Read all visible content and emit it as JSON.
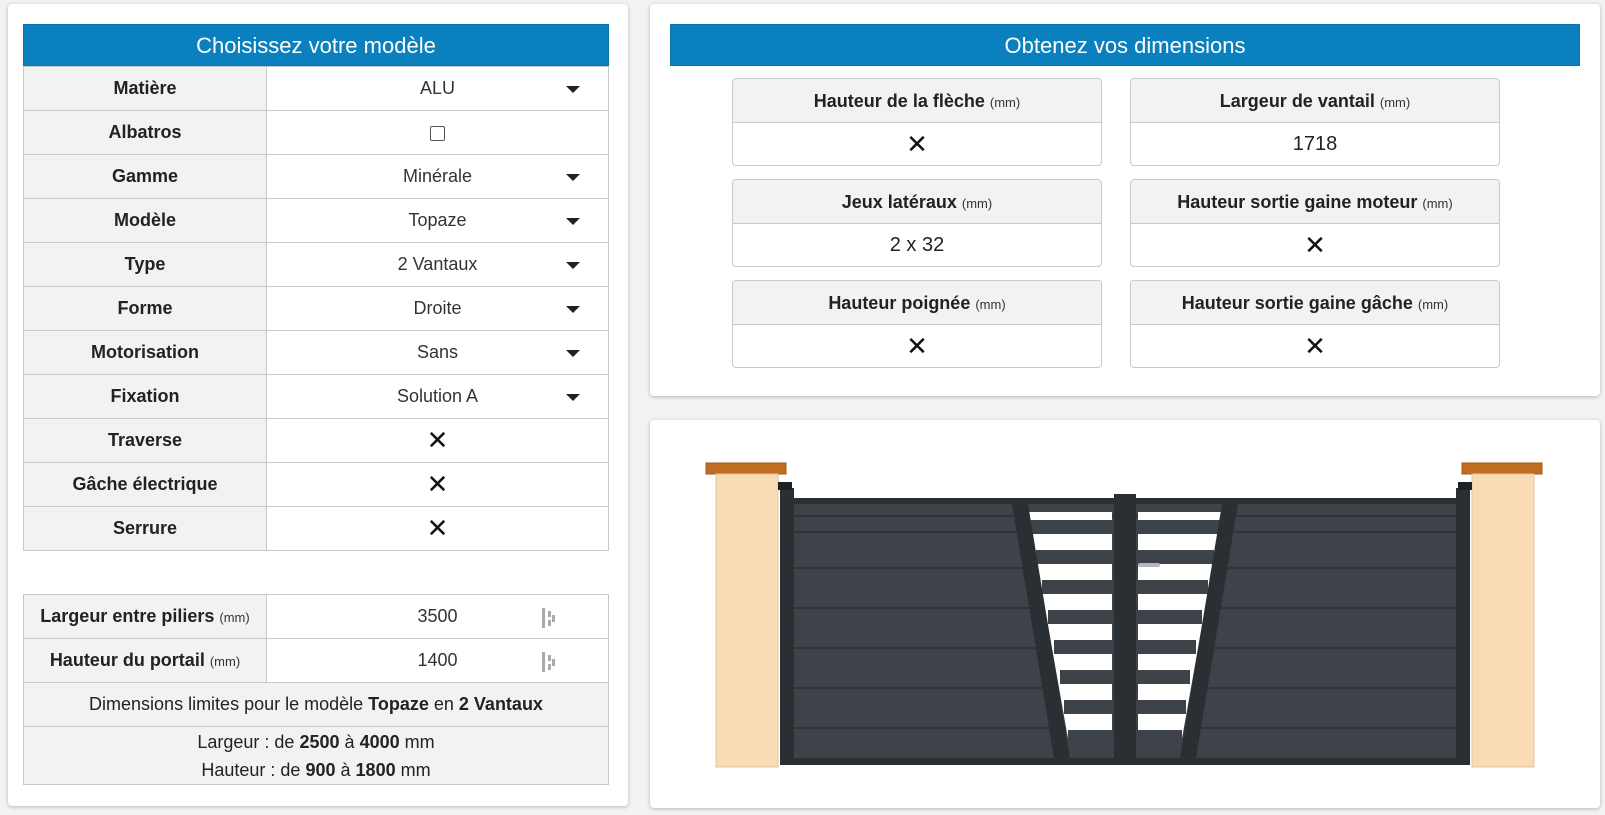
{
  "left_panel": {
    "title": "Choisissez votre modèle",
    "rows": [
      {
        "label": "Matière",
        "value": "ALU",
        "kind": "select"
      },
      {
        "label": "Albatros",
        "value": "",
        "kind": "checkbox",
        "checked": false
      },
      {
        "label": "Gamme",
        "value": "Minérale",
        "kind": "select"
      },
      {
        "label": "Modèle",
        "value": "Topaze",
        "kind": "select"
      },
      {
        "label": "Type",
        "value": "2 Vantaux",
        "kind": "select"
      },
      {
        "label": "Forme",
        "value": "Droite",
        "kind": "select"
      },
      {
        "label": "Motorisation",
        "value": "Sans",
        "kind": "select"
      },
      {
        "label": "Fixation",
        "value": "Solution A",
        "kind": "select"
      },
      {
        "label": "Traverse",
        "value": "✕",
        "kind": "toggle"
      },
      {
        "label": "Gâche électrique",
        "value": "✕",
        "kind": "toggle"
      },
      {
        "label": "Serrure",
        "value": "✕",
        "kind": "toggle"
      }
    ],
    "dimensions": {
      "width_label": "Largeur entre piliers",
      "width_unit": "(mm)",
      "width_value": "3500",
      "height_label": "Hauteur du portail",
      "height_unit": "(mm)",
      "height_value": "1400",
      "limits_prefix": "Dimensions limites pour le modèle",
      "limits_model": "Topaze",
      "limits_mid": "en",
      "limits_type": "2 Vantaux",
      "width_line": {
        "prefix": "Largeur : de",
        "min": "2500",
        "to": "à",
        "max": "4000",
        "unit": "mm"
      },
      "height_line": {
        "prefix": "Hauteur : de",
        "min": "900",
        "to": "à",
        "max": "1800",
        "unit": "mm"
      }
    }
  },
  "right_panel": {
    "title": "Obtenez vos dimensions",
    "boxes": [
      {
        "label": "Hauteur de la flèche",
        "unit": "(mm)",
        "value": "✕"
      },
      {
        "label": "Largeur de vantail",
        "unit": "(mm)",
        "value": "1718"
      },
      {
        "label": "Jeux latéraux",
        "unit": "(mm)",
        "value": "2 x 32"
      },
      {
        "label": "Hauteur sortie gaine moteur",
        "unit": "(mm)",
        "value": "✕"
      },
      {
        "label": "Hauteur poignée",
        "unit": "(mm)",
        "value": "✕"
      },
      {
        "label": "Hauteur sortie gaine gâche",
        "unit": "(mm)",
        "value": "✕"
      }
    ]
  },
  "preview": {
    "pillar_color": "#f9dcb5",
    "cap_color": "#c06d22",
    "gate_color": "#3d4349",
    "frame_color": "#2a2f33"
  }
}
